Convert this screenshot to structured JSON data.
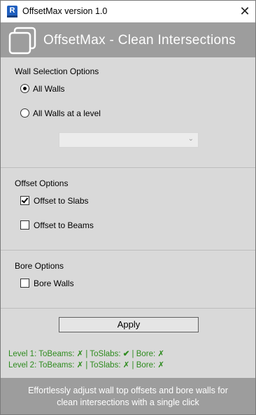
{
  "window": {
    "title": "OffsetMax version 1.0",
    "app_icon_letter": "R",
    "close_glyph": "✕"
  },
  "banner": {
    "title": "OffsetMax - Clean Intersections",
    "logo_icon": "overlapping-squares-icon"
  },
  "wall_selection": {
    "label": "Wall Selection Options",
    "options": [
      {
        "label": "All Walls",
        "selected": true
      },
      {
        "label": "All Walls at a level",
        "selected": false
      }
    ],
    "level_dropdown": {
      "value": "",
      "enabled": false
    }
  },
  "offset_options": {
    "label": "Offset Options",
    "items": [
      {
        "label": "Offset to Slabs",
        "checked": true
      },
      {
        "label": "Offset to Beams",
        "checked": false
      }
    ]
  },
  "bore_options": {
    "label": "Bore Options",
    "items": [
      {
        "label": "Bore Walls",
        "checked": false
      }
    ]
  },
  "apply_label": "Apply",
  "status_lines": [
    {
      "text_a": "Level 1: ToBeams: ",
      "mark_a": "✗",
      "text_b": " | ToSlabs: ",
      "mark_b": "✔",
      "text_c": " | Bore: ",
      "mark_c": "✗"
    },
    {
      "text_a": "Level 2: ToBeams: ",
      "mark_a": "✗",
      "text_b": " | ToSlabs: ",
      "mark_b": "✗",
      "text_c": " | Bore: ",
      "mark_c": "✗"
    }
  ],
  "footer": {
    "line1": "Effortlessly adjust wall top offsets and bore walls for",
    "line2": "clean intersections with a single click"
  },
  "colors": {
    "banner": "#9d9d9d",
    "panel": "#d9d9d9",
    "status_green": "#2e8b1e"
  }
}
